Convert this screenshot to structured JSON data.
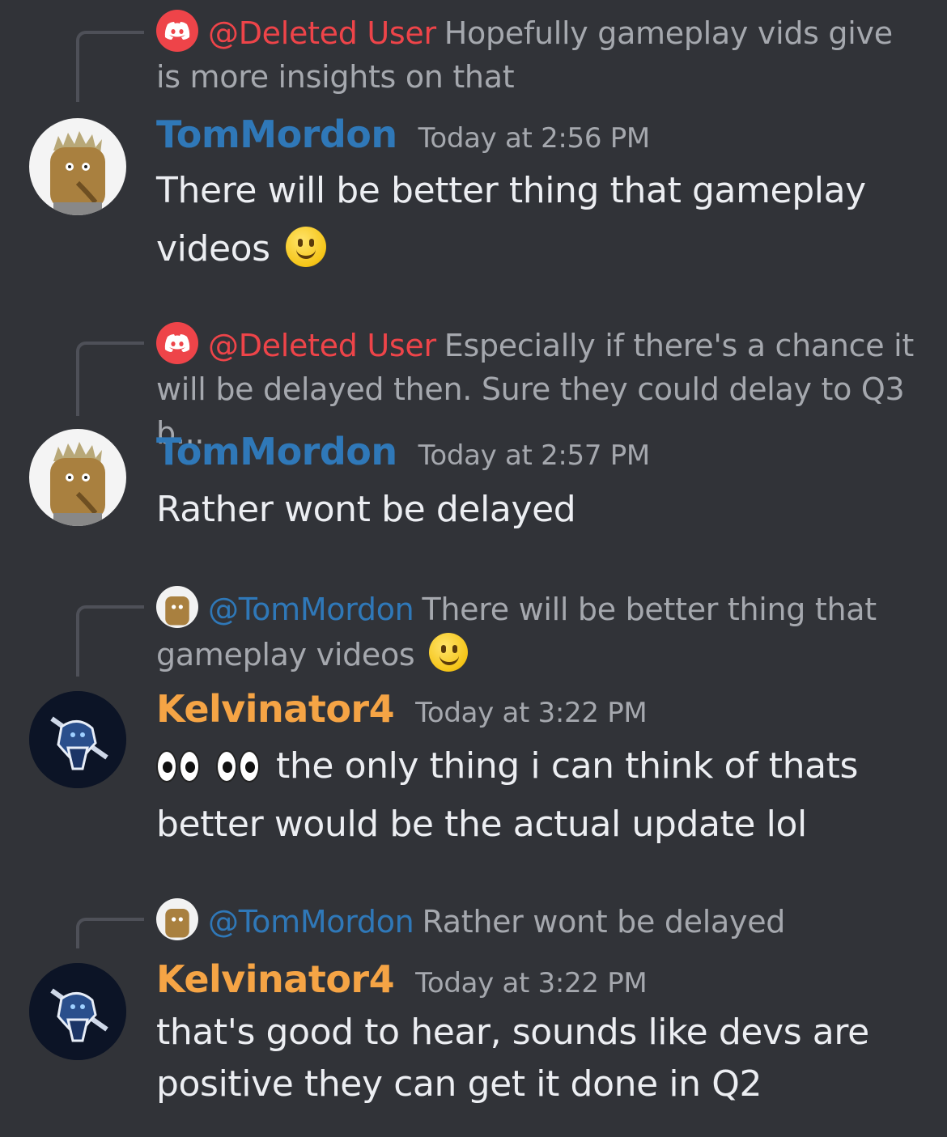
{
  "messages": [
    {
      "reply": {
        "mention": "@Deleted User",
        "text": "Hopefully gameplay vids give is more insights on that",
        "avatar_icon": "discord-logo-icon"
      },
      "author": "TomMordon",
      "timestamp": "Today at 2:56 PM",
      "body": "There will be better thing that gameplay videos",
      "emoji": "slightly-smiling-face-icon"
    },
    {
      "reply": {
        "mention": "@Deleted User",
        "text": "Especially if there's a chance it will be delayed then. Sure they could delay to Q3 b...",
        "avatar_icon": "discord-logo-icon"
      },
      "author": "TomMordon",
      "timestamp": "Today at 2:57 PM",
      "body": "Rather wont be delayed"
    },
    {
      "reply": {
        "mention": "@TomMordon",
        "text": "There will be better thing that gameplay videos",
        "avatar_icon": "tommordon-avatar"
      },
      "author": "Kelvinator4",
      "timestamp": "Today at 3:22 PM",
      "body": "the only thing i can think of thats better would be the actual update lol",
      "emoji": "eyes-icon"
    },
    {
      "reply": {
        "mention": "@TomMordon",
        "text": "Rather wont be delayed",
        "avatar_icon": "tommordon-avatar"
      },
      "author": "Kelvinator4",
      "timestamp": "Today at 3:22 PM",
      "body": "that's good to hear, sounds like devs are positive they can get it done in Q2"
    }
  ],
  "colors": {
    "background": "#313338",
    "deleted_user_mention": "#ee4449",
    "tommordon_name": "#2f78b8",
    "kelvinator_name": "#f5a445",
    "muted_text": "#a5a8ae",
    "body_text": "#eceef2"
  }
}
